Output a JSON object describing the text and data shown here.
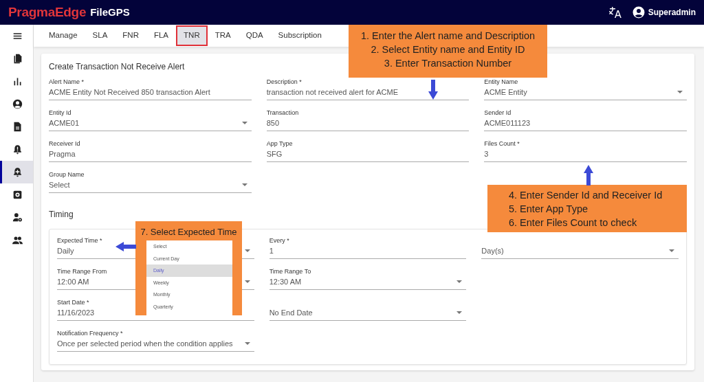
{
  "header": {
    "brand": "PragmaEdge",
    "product": "FileGPS",
    "user": "Superadmin"
  },
  "sidebar": {
    "items": [
      {
        "kind": "menu",
        "selected": false
      },
      {
        "kind": "files",
        "selected": false
      },
      {
        "kind": "chart",
        "selected": false
      },
      {
        "kind": "account",
        "selected": false
      },
      {
        "kind": "document",
        "selected": false
      },
      {
        "kind": "bell",
        "selected": false
      },
      {
        "kind": "bell-plus",
        "selected": true
      },
      {
        "kind": "gear",
        "selected": false
      },
      {
        "kind": "user-gear",
        "selected": false
      },
      {
        "kind": "group",
        "selected": false
      }
    ]
  },
  "tabs": [
    {
      "label": "Manage",
      "selected": false
    },
    {
      "label": "SLA",
      "selected": false
    },
    {
      "label": "FNR",
      "selected": false
    },
    {
      "label": "FLA",
      "selected": false
    },
    {
      "label": "TNR",
      "selected": true
    },
    {
      "label": "TRA",
      "selected": false
    },
    {
      "label": "QDA",
      "selected": false
    },
    {
      "label": "Subscription",
      "selected": false
    }
  ],
  "form": {
    "title": "Create Transaction Not Receive Alert",
    "rows": [
      [
        {
          "label": "Alert Name *",
          "value": "ACME Entity Not Received 850 transaction Alert",
          "dropdown": false
        },
        {
          "label": "Description *",
          "value": "transaction not received alert for ACME",
          "dropdown": false
        },
        {
          "label": "Entity Name",
          "value": "ACME Entity",
          "dropdown": true
        }
      ],
      [
        {
          "label": "Entity Id",
          "value": "ACME01",
          "dropdown": true
        },
        {
          "label": "Transaction",
          "value": "850",
          "dropdown": false
        },
        {
          "label": "Sender Id",
          "value": "ACME011123",
          "dropdown": false
        }
      ],
      [
        {
          "label": "Receiver Id",
          "value": "Pragma",
          "dropdown": false
        },
        {
          "label": "App Type",
          "value": "SFG",
          "dropdown": false
        },
        {
          "label": "Files Count *",
          "value": "3",
          "dropdown": false
        }
      ],
      [
        {
          "label": "Group Name",
          "value": "Select",
          "dropdown": true
        }
      ]
    ]
  },
  "timing": {
    "title": "Timing",
    "rows": [
      [
        {
          "label": "Expected Time *",
          "value": "Daily",
          "dropdown": true
        },
        {
          "label": "Every *",
          "value": "1",
          "dropdown": false
        },
        {
          "value": "Day(s)",
          "dropdown": true
        }
      ],
      [
        {
          "label": "Time Range From",
          "value": "12:00 AM",
          "dropdown": true
        },
        {
          "label": "Time Range To",
          "value": "12:30 AM",
          "dropdown": true
        }
      ],
      [
        {
          "label": "Start Date *",
          "value": "11/16/2023",
          "dropdown": false
        },
        {
          "value": "No End Date",
          "dropdown": true
        }
      ],
      [
        {
          "label": "Notification Frequency *",
          "value": "Once per selected period when the condition applies",
          "dropdown": true
        }
      ]
    ]
  },
  "callouts": [
    {
      "lines": [
        "1. Enter the Alert name and Description",
        "2. Select Entity name and Entity ID",
        "3. Enter Transaction Number"
      ]
    },
    {
      "lines": [
        "4. Enter Sender Id and Receiver Id",
        "5. Enter App Type",
        "6. Enter Files Count to check"
      ]
    },
    {
      "lines": [
        "7. Select Expected Time"
      ],
      "options": [
        {
          "label": "Select",
          "selected": false
        },
        {
          "label": "Current Day",
          "selected": false
        },
        {
          "label": "Daily",
          "selected": true
        },
        {
          "label": "Weekly",
          "selected": false
        },
        {
          "label": "Monthly",
          "selected": false
        },
        {
          "label": "Quarterly",
          "selected": false
        }
      ]
    }
  ]
}
